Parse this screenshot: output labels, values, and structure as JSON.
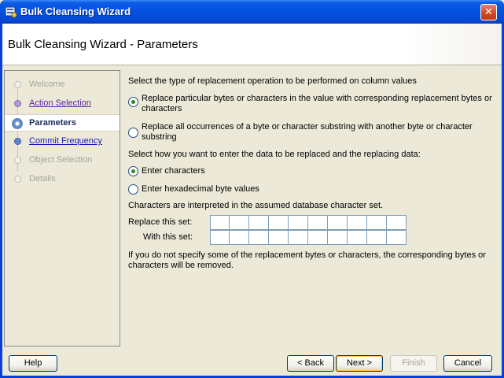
{
  "window": {
    "title": "Bulk Cleansing Wizard",
    "close_glyph": "✕"
  },
  "header": {
    "title": "Bulk Cleansing Wizard - Parameters"
  },
  "steps": [
    {
      "label": "Welcome",
      "state": "disabled"
    },
    {
      "label": "Action Selection",
      "state": "visited"
    },
    {
      "label": "Parameters",
      "state": "current"
    },
    {
      "label": "Commit Frequency",
      "state": "link"
    },
    {
      "label": "Object Selection",
      "state": "disabled"
    },
    {
      "label": "Details",
      "state": "disabled"
    }
  ],
  "content": {
    "operation_prompt": "Select the type of replacement operation to be performed on column values",
    "op_option1_line1": "Replace particular bytes or characters in the value with corresponding replacement bytes or",
    "op_option1_line2": "characters",
    "op_option2_line1": "Replace all occurrences of a byte or character substring with another byte or character",
    "op_option2_line2": "substring",
    "entry_prompt": "Select how you want to enter the data to be replaced and the replacing data:",
    "entry_option1": "Enter characters",
    "entry_option2": "Enter hexadecimal byte values",
    "charset_note": "Characters are interpreted in the assumed database character set.",
    "replace_label": "Replace this set:",
    "with_label": "With this set:",
    "footer_note_line1": "If you do not specify some of the replacement bytes or characters, the corresponding bytes or",
    "footer_note_line2": "characters will be removed."
  },
  "buttons": {
    "help": "Help",
    "back": "< Back",
    "next": "Next >",
    "finish": "Finish",
    "cancel": "Cancel"
  },
  "colors": {
    "titlebar": "#0553e1",
    "link": "#1a1ab4",
    "visited": "#5a2a9a"
  }
}
